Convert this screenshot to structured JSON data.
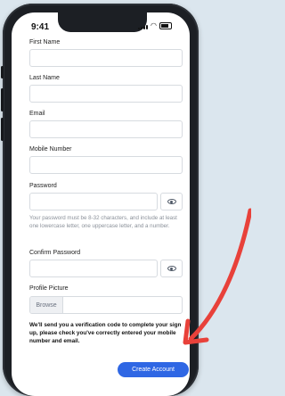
{
  "status_bar": {
    "time": "9:41"
  },
  "form": {
    "first_name_label": "First Name",
    "last_name_label": "Last Name",
    "email_label": "Email",
    "mobile_label": "Mobile Number",
    "password_label": "Password",
    "password_hint": "Your password must be 8-32 characters, and include at least one lowercase letter, one uppercase letter, and a number.",
    "confirm_password_label": "Confirm Password",
    "profile_picture_label": "Profile Picture",
    "browse_label": "Browse",
    "verification_note": "We'll send you a verification code to complete your sign up, please check you've correctly entered your mobile number and email.",
    "submit_label": "Create Account"
  },
  "icons": [
    "signal-icon",
    "wifi-icon",
    "battery-icon",
    "eye-icon",
    "arrow-annotation"
  ],
  "colors": {
    "accent": "#2f67e4",
    "arrow": "#e8413a",
    "background": "#dbe6ee"
  }
}
